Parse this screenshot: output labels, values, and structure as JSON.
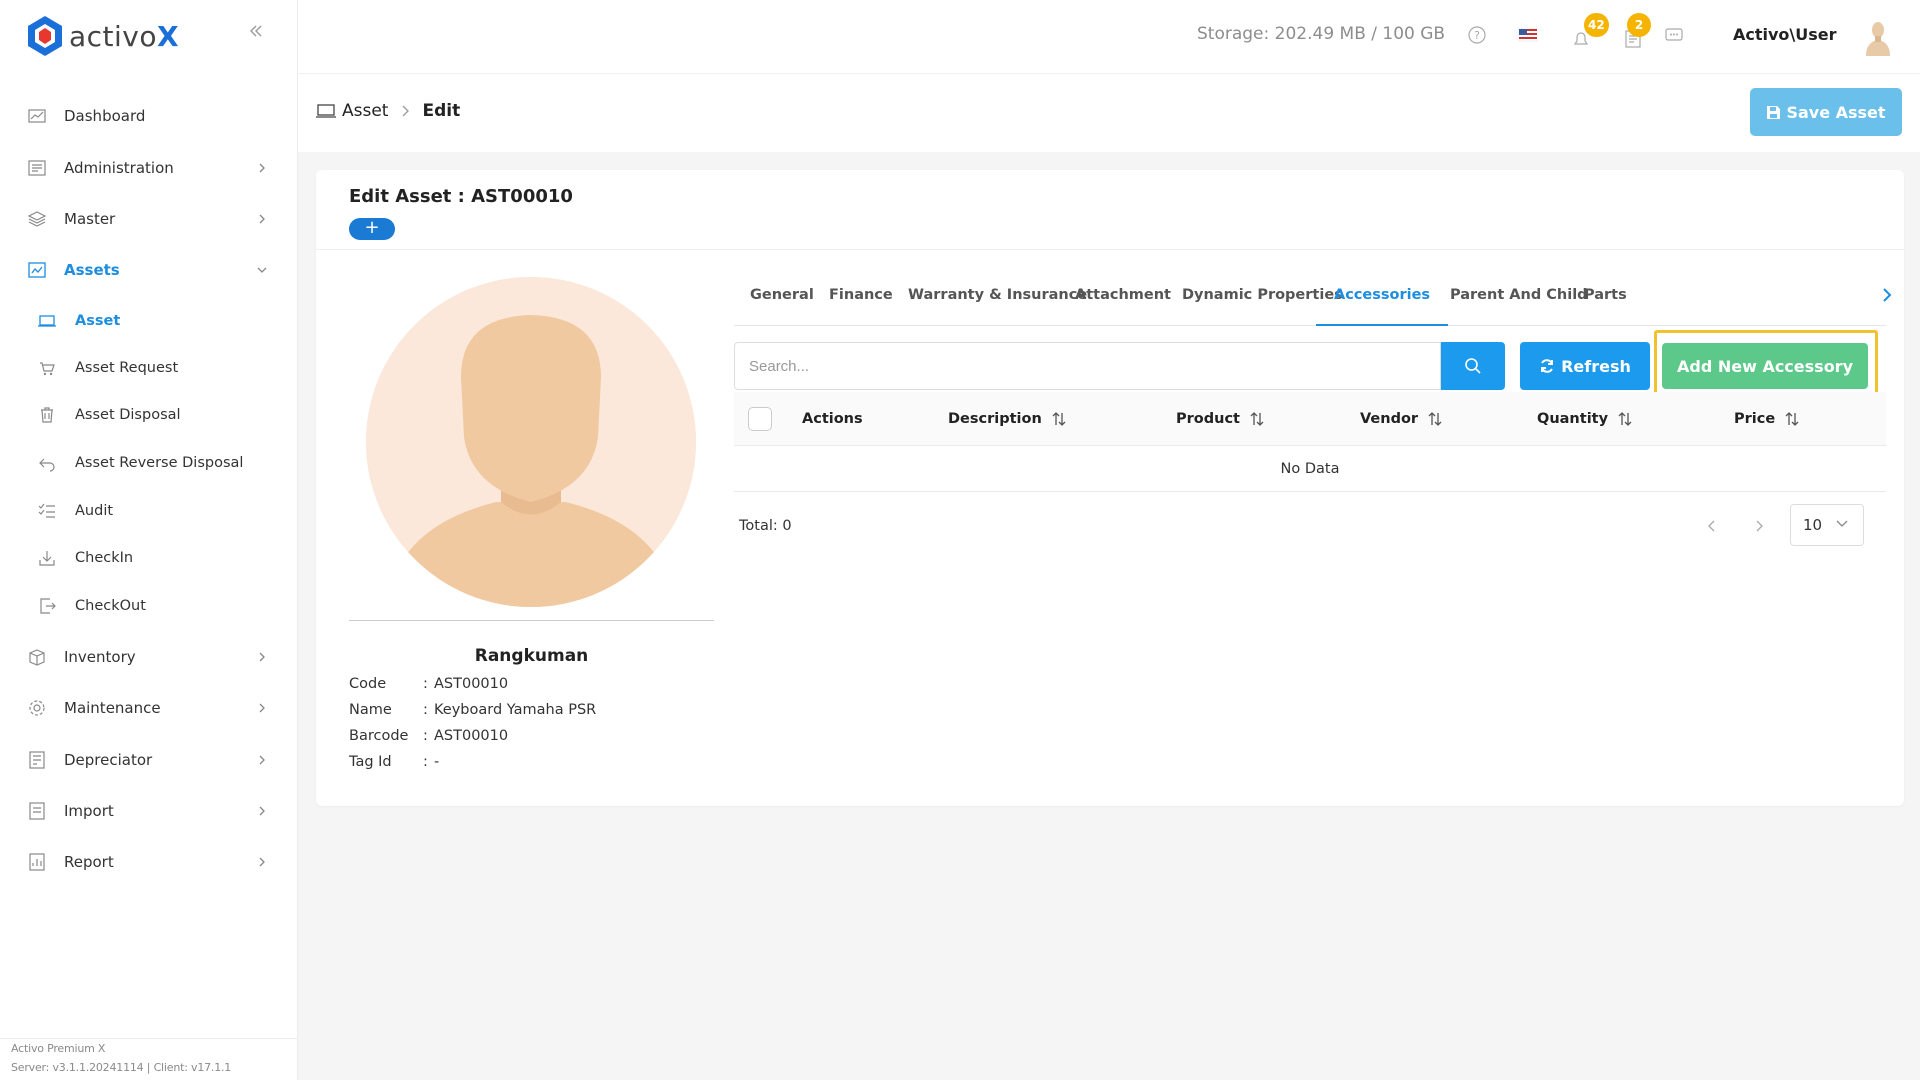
{
  "app": {
    "logo_text": "activo",
    "logo_accent": "X",
    "brand_color": "#1b6fd8",
    "accent_color": "#1d8de0"
  },
  "sidebar": {
    "items": [
      {
        "label": "Dashboard",
        "icon": "chart-icon",
        "has_children": false
      },
      {
        "label": "Administration",
        "icon": "admin-icon",
        "has_children": true
      },
      {
        "label": "Master",
        "icon": "layers-icon",
        "has_children": true
      },
      {
        "label": "Assets",
        "icon": "assets-icon",
        "has_children": true,
        "expanded": true,
        "active": true
      },
      {
        "label": "Inventory",
        "icon": "inventory-icon",
        "has_children": true
      },
      {
        "label": "Maintenance",
        "icon": "gear-icon",
        "has_children": true
      },
      {
        "label": "Depreciator",
        "icon": "depreciator-icon",
        "has_children": true
      },
      {
        "label": "Import",
        "icon": "import-icon",
        "has_children": true
      },
      {
        "label": "Report",
        "icon": "report-icon",
        "has_children": true
      }
    ],
    "sub_items": [
      {
        "label": "Asset",
        "icon": "laptop-icon",
        "active": true
      },
      {
        "label": "Asset Request",
        "icon": "cart-icon"
      },
      {
        "label": "Asset Disposal",
        "icon": "trash-icon"
      },
      {
        "label": "Asset Reverse Disposal",
        "icon": "undo-icon"
      },
      {
        "label": "Audit",
        "icon": "checklist-icon"
      },
      {
        "label": "CheckIn",
        "icon": "checkin-icon"
      },
      {
        "label": "CheckOut",
        "icon": "checkout-icon"
      }
    ],
    "version_line1": "Activo Premium X",
    "version_line2": "Server: v3.1.1.20241114 | Client: v17.1.1"
  },
  "header": {
    "storage": "Storage: 202.49 MB / 100 GB",
    "notifications_count": "42",
    "tasks_count": "2",
    "user_name": "Activo\\User",
    "badge_color": "#f5b400"
  },
  "breadcrumb": {
    "parent": "Asset",
    "current": "Edit"
  },
  "toolbar": {
    "save_label": "Save Asset"
  },
  "card": {
    "title": "Edit Asset : AST00010",
    "plus_label": "+"
  },
  "summary": {
    "title": "Rangkuman",
    "rows": [
      {
        "key": "Code",
        "colon": ":",
        "value": "AST00010"
      },
      {
        "key": "Name",
        "colon": ":",
        "value": "Keyboard Yamaha PSR"
      },
      {
        "key": "Barcode",
        "colon": ":",
        "value": "AST00010"
      },
      {
        "key": "Tag Id",
        "colon": ":",
        "value": "-"
      }
    ]
  },
  "tabs": [
    {
      "label": "General"
    },
    {
      "label": "Finance"
    },
    {
      "label": "Warranty & Insurance"
    },
    {
      "label": "Attachment"
    },
    {
      "label": "Dynamic Properties"
    },
    {
      "label": "Accessories",
      "active": true
    },
    {
      "label": "Parent And Child"
    },
    {
      "label": "Parts"
    }
  ],
  "search": {
    "placeholder": "Search...",
    "value": ""
  },
  "buttons": {
    "refresh_label": "Refresh",
    "add_label": "Add New Accessory",
    "add_color": "#5cc98a",
    "highlight_color": "#f2c12e"
  },
  "table": {
    "columns": [
      "Actions",
      "Description",
      "Product",
      "Vendor",
      "Quantity",
      "Price"
    ],
    "empty_text": "No Data",
    "rows": []
  },
  "pagination": {
    "total_text": "Total: 0",
    "page_size": "10"
  }
}
